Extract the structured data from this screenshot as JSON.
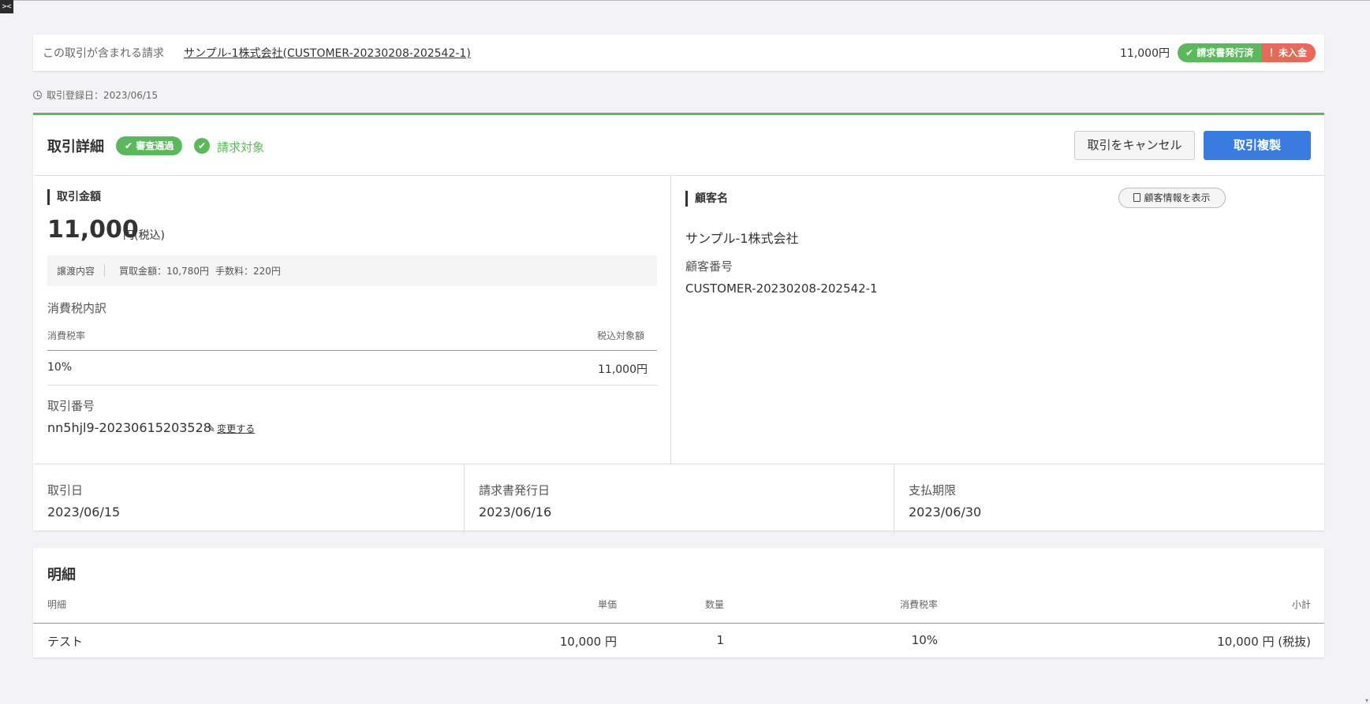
{
  "toolbar": {
    "toggle_label": "><"
  },
  "invoice_bar": {
    "label": "この取引が含まれる請求",
    "link": "サンプル-1株式会社(CUSTOMER-20230208-202542-1)",
    "amount": "11,000円",
    "badge_issued": "✔ 請求書発行済",
    "badge_unpaid": "！未入金"
  },
  "registered": {
    "text": "取引登録日：2023/06/15"
  },
  "detail": {
    "title": "取引詳細",
    "review_badge": "✔ 審査通過",
    "billing_target": "請求対象",
    "cancel_button": "取引をキャンセル",
    "duplicate_button": "取引複製",
    "amount_section": "取引金額",
    "amount": "11,000",
    "amount_unit": "円(税込)",
    "transfer_label": "譲渡内容",
    "purchase_amount": "買取金額：10,780円",
    "fee": "手数料：220円",
    "tax_title": "消費税内訳",
    "tax_header_rate": "消費税率",
    "tax_header_amount": "税込対象額",
    "tax_rate": "10%",
    "tax_amount": "11,000円",
    "txn_number_label": "取引番号",
    "txn_number": "nn5hjl9-20230615203528",
    "change_link": "変更する",
    "customer_section": "顧客名",
    "customer_info_button": "顧客情報を表示",
    "customer_name": "サンプル-1株式会社",
    "customer_number_label": "顧客番号",
    "customer_number": "CUSTOMER-20230208-202542-1",
    "dates": [
      {
        "label": "取引日",
        "value": "2023/06/15"
      },
      {
        "label": "請求書発行日",
        "value": "2023/06/16"
      },
      {
        "label": "支払期限",
        "value": "2023/06/30"
      }
    ]
  },
  "items": {
    "title": "明細",
    "headers": [
      "明細",
      "単価",
      "数量",
      "消費税率",
      "小計"
    ],
    "rows": [
      [
        "テスト",
        "10,000 円",
        "1",
        "10%",
        "10,000 円 (税抜)"
      ]
    ]
  },
  "colors": {
    "accent_green": "#5cb85c",
    "primary_blue": "#3a7be0",
    "danger_red": "#e8685a"
  }
}
